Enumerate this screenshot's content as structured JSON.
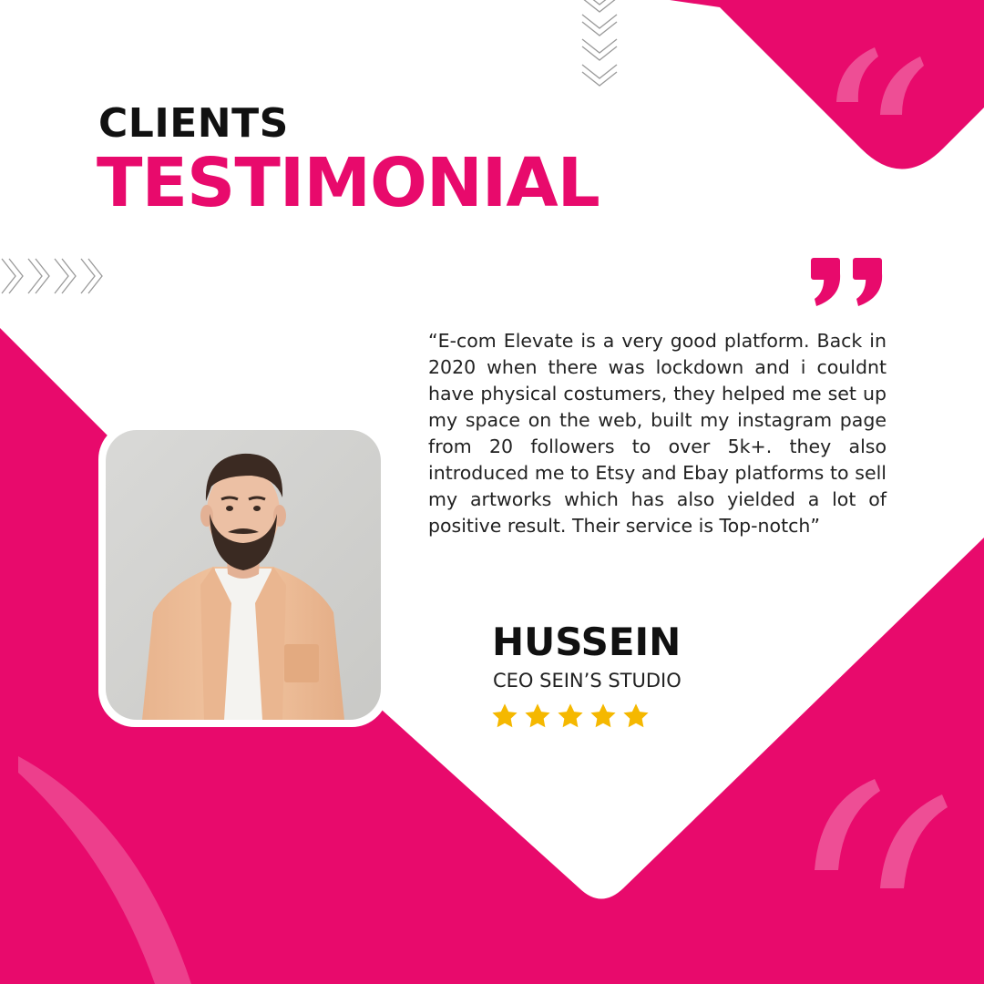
{
  "heading": {
    "small": "CLIENTS",
    "big": "TESTIMONIAL"
  },
  "testimonial": {
    "quote": "“E-com Elevate is a very good platform. Back in 2020 when there was lockdown and i couldnt have physical costumers, they helped me set up my space on the web, built my instagram page from 20 followers to over 5k+. they also introduced me to Etsy and Ebay platforms to sell my artworks which has also yielded a lot of positive result. Their service is Top-notch”",
    "author_name": "HUSSEIN",
    "author_title": "CEO SEIN’S STUDIO",
    "rating": 5
  },
  "colors": {
    "brand_pink": "#e80a6c",
    "star_gold": "#f5b800",
    "text_dark": "#111111"
  },
  "icons": [
    "quote-mark-icon",
    "chevron-arrows-icon",
    "star-icon",
    "decorative-quote-icon"
  ]
}
